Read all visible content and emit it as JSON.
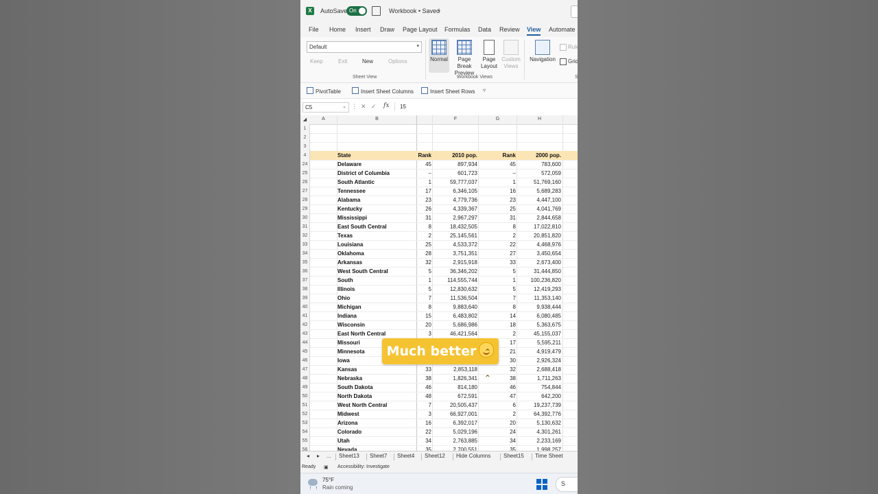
{
  "titlebar": {
    "logo": "X",
    "autosave_label": "AutoSave",
    "autosave_state": "On",
    "workbook_name": "Workbook • Saved"
  },
  "ribbon_tabs": [
    "File",
    "Home",
    "Insert",
    "Draw",
    "Page Layout",
    "Formulas",
    "Data",
    "Review",
    "View",
    "Automate"
  ],
  "active_tab": "View",
  "ribbon": {
    "sheet_view": {
      "select_value": "Default",
      "keep": "Keep",
      "exit": "Exit",
      "new": "New",
      "options": "Options",
      "group_label": "Sheet View"
    },
    "workbook_views": {
      "normal": "Normal",
      "page_break_1": "Page Break",
      "page_break_2": "Preview",
      "page_layout_1": "Page",
      "page_layout_2": "Layout",
      "custom_1": "Custom",
      "custom_2": "Views",
      "group_label": "Workbook Views"
    },
    "show": {
      "navigation": "Navigation",
      "ruler": "Rule",
      "gridlines": "Grid",
      "group_label": "S"
    }
  },
  "quick_toolbar": {
    "pivot": "PivotTable",
    "insert_cols": "Insert Sheet Columns",
    "insert_rows": "Insert Sheet Rows"
  },
  "formula_bar": {
    "name_box": "C5",
    "fx": "fx",
    "value": "15"
  },
  "columns": [
    "A",
    "B",
    "",
    "F",
    "G",
    "H"
  ],
  "header_row": {
    "num": "4",
    "state": "State",
    "rank1": "Rank",
    "pop2010": "2010 pop.",
    "rank2": "Rank",
    "pop2000": "2000 pop."
  },
  "empty_rows": [
    "1",
    "2",
    "3"
  ],
  "rows": [
    [
      "24",
      "Delaware",
      "45",
      "897,934",
      "45",
      "783,600"
    ],
    [
      "25",
      "District of Columbia",
      "–",
      "601,723",
      "–",
      "572,059"
    ],
    [
      "26",
      "South Atlantic",
      "1",
      "59,777,037",
      "1",
      "51,769,160"
    ],
    [
      "27",
      "Tennessee",
      "17",
      "6,346,105",
      "16",
      "5,689,283"
    ],
    [
      "28",
      "Alabama",
      "23",
      "4,779,736",
      "23",
      "4,447,100"
    ],
    [
      "29",
      "Kentucky",
      "26",
      "4,339,367",
      "25",
      "4,041,769"
    ],
    [
      "30",
      "Mississippi",
      "31",
      "2,967,297",
      "31",
      "2,844,658"
    ],
    [
      "31",
      "East South Central",
      "8",
      "18,432,505",
      "8",
      "17,022,810"
    ],
    [
      "32",
      "Texas",
      "2",
      "25,145,561",
      "2",
      "20,851,820"
    ],
    [
      "33",
      "Louisiana",
      "25",
      "4,533,372",
      "22",
      "4,468,976"
    ],
    [
      "34",
      "Oklahoma",
      "28",
      "3,751,351",
      "27",
      "3,450,654"
    ],
    [
      "35",
      "Arkansas",
      "32",
      "2,915,918",
      "33",
      "2,673,400"
    ],
    [
      "36",
      "West South Central",
      "5",
      "36,346,202",
      "5",
      "31,444,850"
    ],
    [
      "37",
      "South",
      "1",
      "114,555,744",
      "1",
      "100,236,820"
    ],
    [
      "38",
      "Illinois",
      "5",
      "12,830,632",
      "5",
      "12,419,293"
    ],
    [
      "39",
      "Ohio",
      "7",
      "11,536,504",
      "7",
      "11,353,140"
    ],
    [
      "40",
      "Michigan",
      "8",
      "9,883,640",
      "8",
      "9,938,444"
    ],
    [
      "41",
      "Indiana",
      "15",
      "6,483,802",
      "14",
      "6,080,485"
    ],
    [
      "42",
      "Wisconsin",
      "20",
      "5,686,986",
      "18",
      "5,363,675"
    ],
    [
      "43",
      "East North Central",
      "3",
      "46,421,564",
      "2",
      "45,155,037"
    ],
    [
      "44",
      "Missouri",
      "",
      "",
      "17",
      "5,595,211"
    ],
    [
      "45",
      "Minnesota",
      "",
      "",
      "21",
      "4,919,479"
    ],
    [
      "46",
      "Iowa",
      "",
      "",
      "30",
      "2,926,324"
    ],
    [
      "47",
      "Kansas",
      "33",
      "2,853,118",
      "32",
      "2,688,418"
    ],
    [
      "48",
      "Nebraska",
      "38",
      "1,826,341",
      "38",
      "1,711,263"
    ],
    [
      "49",
      "South Dakota",
      "46",
      "814,180",
      "46",
      "754,844"
    ],
    [
      "50",
      "North Dakota",
      "48",
      "672,591",
      "47",
      "642,200"
    ],
    [
      "51",
      "West North Central",
      "7",
      "20,505,437",
      "6",
      "19,237,739"
    ],
    [
      "52",
      "Midwest",
      "3",
      "66,927,001",
      "2",
      "64,392,776"
    ],
    [
      "53",
      "Arizona",
      "16",
      "6,392,017",
      "20",
      "5,130,632"
    ],
    [
      "54",
      "Colorado",
      "22",
      "5,029,196",
      "24",
      "4,301,261"
    ],
    [
      "55",
      "Utah",
      "34",
      "2,763,885",
      "34",
      "2,233,169"
    ],
    [
      "56",
      "Nevada",
      "35",
      "2,700,551",
      "35",
      "1,998,257"
    ]
  ],
  "caption": "Much better",
  "sheet_tabs": [
    "Sheet13",
    "Sheet7",
    "Sheet4",
    "Sheet12",
    "Hide Columns",
    "Sheet15",
    "Time Sheet"
  ],
  "sheet_nav": {
    "prev": "◂",
    "next": "▸",
    "more": "..."
  },
  "status": {
    "ready": "Ready",
    "accessibility": "Accessibility: Investigate"
  },
  "taskbar": {
    "temp": "75°F",
    "weather": "Rain coming",
    "search": "S"
  },
  "colors": {
    "excel_green": "#1e7145",
    "header_fill": "#fbe5b4",
    "caption_bg": "#f5c332"
  }
}
